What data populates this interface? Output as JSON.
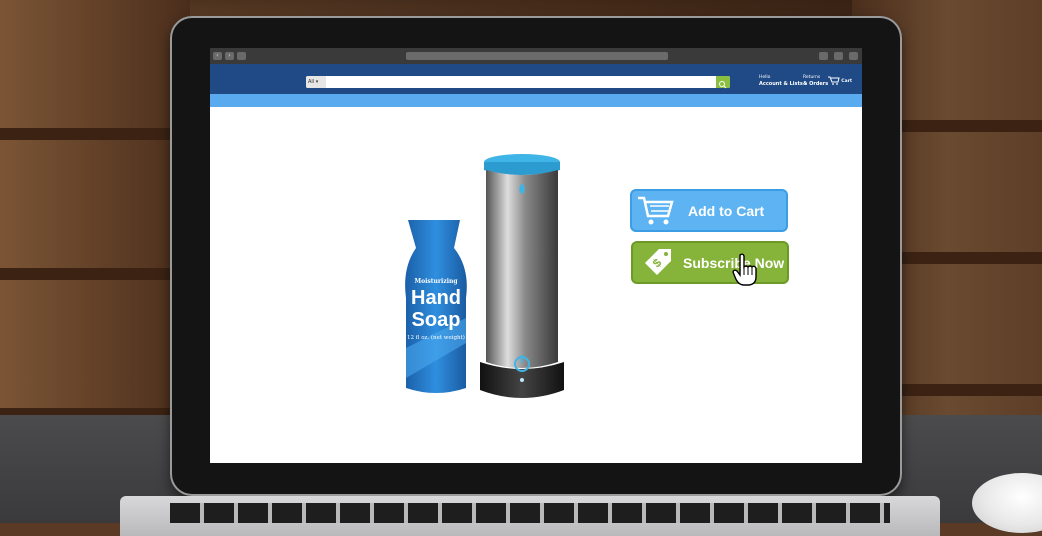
{
  "browser": {
    "search_category": "All ▾",
    "header_links": {
      "account_greeting": "Hello",
      "account_label": "Account & Lists ▾",
      "returns_line1": "Returns",
      "returns_line2": "& Orders",
      "cart_label": "Cart"
    }
  },
  "product": {
    "bottle_line1": "Moisturizing",
    "bottle_line2": "Hand",
    "bottle_line3": "Soap",
    "bottle_line4": "12 fl oz. (net weight)"
  },
  "actions": {
    "add_to_cart": "Add to Cart",
    "subscribe_now": "Subscribe Now"
  },
  "colors": {
    "header": "#1f4a86",
    "subheader": "#5aaaf0",
    "add_to_cart": "#5eb4f2",
    "subscribe": "#86b33a"
  },
  "icons": [
    "cart-icon",
    "tag-dollar-icon",
    "hand-cursor-icon",
    "search-icon",
    "power-icon"
  ]
}
